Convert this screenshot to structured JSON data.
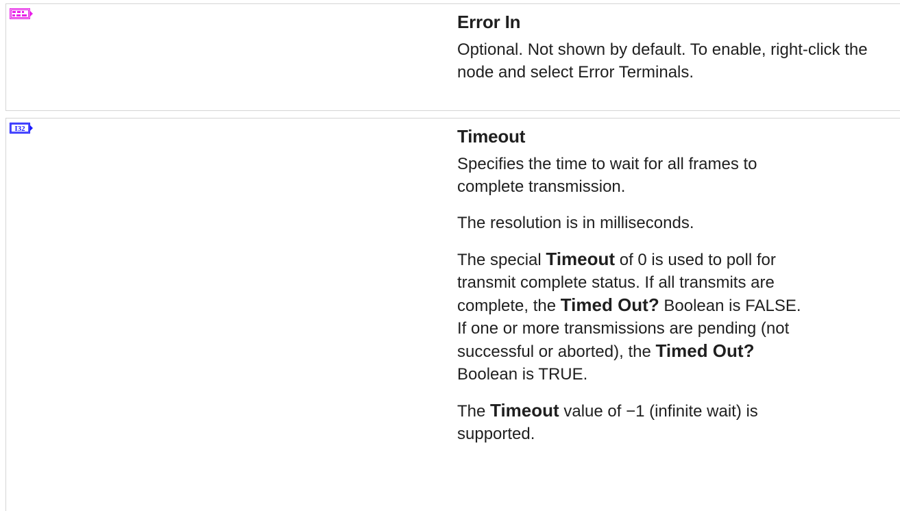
{
  "params": [
    {
      "icon": "error-cluster-terminal-icon",
      "icon_color": "#e820e8",
      "title": "Error In",
      "desc": "Optional. Not shown by default. To enable, right-click the node and select Error Terminals."
    },
    {
      "icon": "i32-terminal-icon",
      "icon_text": "I32",
      "icon_color": "#1a1aff",
      "title": "Timeout",
      "p1": "Specifies the time to wait for all frames to complete transmission.",
      "p2": "The resolution is in milliseconds.",
      "p3": {
        "a": "The special ",
        "b": "Timeout",
        "c": " of 0 is used to poll for transmit complete status. If all transmits are complete, the ",
        "d": "Timed Out?",
        "e": " Boolean is FALSE. If one or more transmissions are pending (not successful or aborted), the ",
        "f": "Timed Out?",
        "g": " Boolean is TRUE."
      },
      "p4": {
        "a": "The ",
        "b": "Timeout",
        "c": " value of −1 (infinite wait) is supported."
      }
    }
  ]
}
